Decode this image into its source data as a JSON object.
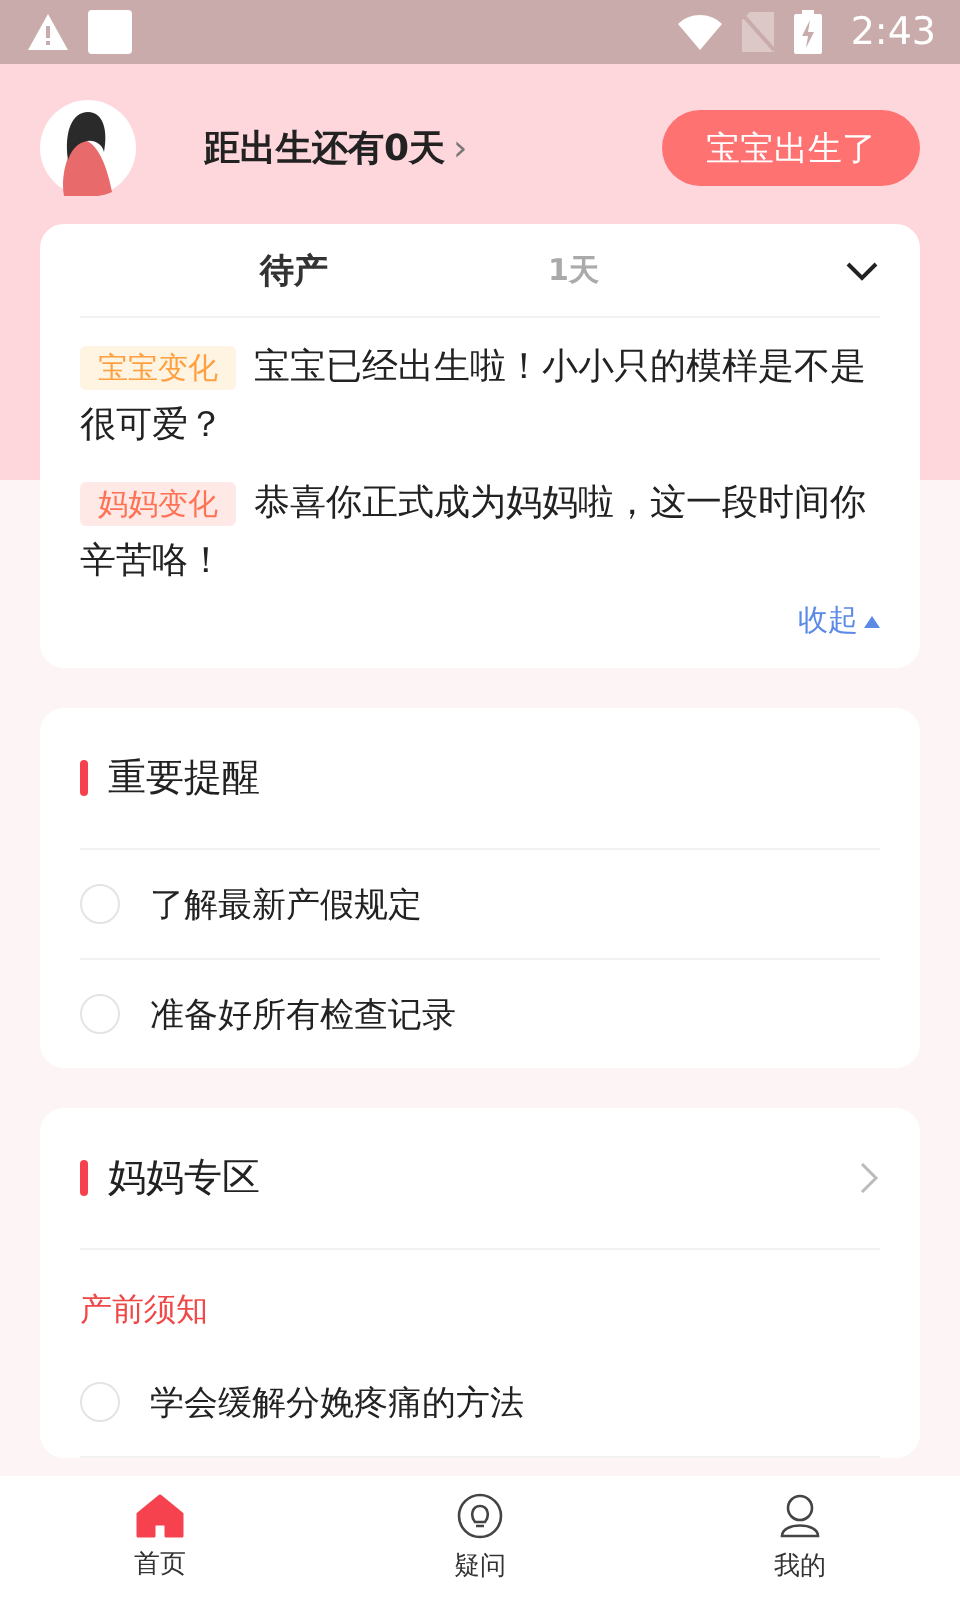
{
  "status_bar": {
    "time": "2:43"
  },
  "header": {
    "countdown": "距出生还有0天",
    "chevron": "›",
    "button": "宝宝出生了"
  },
  "stage_card": {
    "tabs": [
      {
        "label": "待产",
        "selected": true
      },
      {
        "label": "1天",
        "selected": false
      }
    ],
    "changes": [
      {
        "kind": "baby",
        "tag": "宝宝变化",
        "text": "宝宝已经出生啦！小小只的模样是不是很可爱？"
      },
      {
        "kind": "mom",
        "tag": "妈妈变化",
        "text": "恭喜你正式成为妈妈啦，这一段时间你辛苦咯！"
      }
    ],
    "collapse": "收起"
  },
  "reminders": {
    "title": "重要提醒",
    "items": [
      {
        "label": "了解最新产假规定",
        "checked": false
      },
      {
        "label": "准备好所有检查记录",
        "checked": false
      }
    ]
  },
  "mom_zone": {
    "title": "妈妈专区",
    "subtitle": "产前须知",
    "items": [
      {
        "label": "学会缓解分娩疼痛的方法",
        "checked": false
      }
    ]
  },
  "nav": [
    {
      "label": "首页",
      "kind": "home",
      "selected": true
    },
    {
      "label": "疑问",
      "kind": "bulb",
      "selected": false
    },
    {
      "label": "我的",
      "kind": "user",
      "selected": false
    }
  ]
}
